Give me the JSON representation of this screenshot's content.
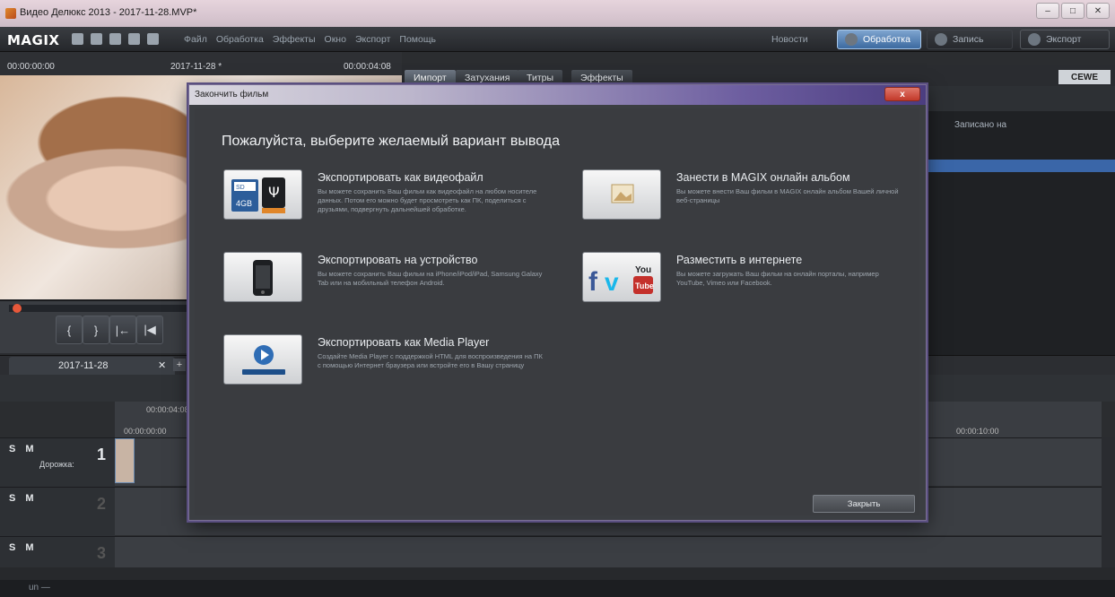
{
  "window": {
    "title": "Видео Делюкс 2013 - 2017-11-28.MVP*"
  },
  "menubar": {
    "logo": "MAGIX",
    "items": [
      "Файл",
      "Обработка",
      "Эффекты",
      "Окно",
      "Экспорт",
      "Помощь"
    ],
    "news": "Новости",
    "modes": {
      "processing": "Обработка",
      "record": "Запись",
      "export": "Экспорт"
    }
  },
  "monitor": {
    "timecode_left": "00:00:00:00",
    "project": "2017-11-28 *",
    "timecode_right": "00:00:04:08"
  },
  "media_tabs": [
    "Импорт",
    "Затухания",
    "Титры",
    "Эффекты"
  ],
  "brand_badge": "CEWE",
  "media_panel": {
    "column_recorded": "Записано на"
  },
  "timeline": {
    "tab_label": "2017-11-28",
    "ruler_marks": [
      "00:00:00:00",
      "00:00:04:08",
      "00:00:10:00"
    ],
    "tracks": [
      {
        "number": "1",
        "label": "Дорожка:"
      },
      {
        "number": "2",
        "label": ""
      },
      {
        "number": "3",
        "label": ""
      }
    ],
    "track_buttons": "S M"
  },
  "status": {
    "text": "un —"
  },
  "dialog": {
    "title": "Закончить фильм",
    "close_glyph": "x",
    "heading": "Пожалуйста, выберите желаемый вариант вывода",
    "options": {
      "video_file": {
        "title": "Экспортировать как видеофайл",
        "desc": "Вы можете сохранить Ваш фильм как видеофайл на любом носителе данных. Потом его можно будет просмотреть как ПК, поделиться с друзьями, подвергнуть дальнейшей обработке."
      },
      "device": {
        "title": "Экспортировать на устройство",
        "desc": "Вы можете сохранить Ваш фильм на iPhone/iPod/iPad, Samsung Galaxy Tab или на мобильный телефон Android."
      },
      "media_player": {
        "title": "Экспортировать как Media Player",
        "desc": "Создайте Media Player с поддержкой HTML для воспроизведения на ПК с помощью Интернет браузера или встройте его в Вашу страницу"
      },
      "online_album": {
        "title": "Занести в MAGIX онлайн альбом",
        "desc": "Вы можете внести Ваш фильм в MAGIX онлайн альбом Вашей личной веб-страницы"
      },
      "internet": {
        "title": "Разместить в интернете",
        "desc": "Вы можете загружать Ваш фильм на онлайн порталы, например YouTube, Vimeo или Facebook."
      }
    },
    "close_button": "Закрыть"
  },
  "colors": {
    "accent": "#3c6aa0",
    "dialog_title": "#6d5ea0",
    "close": "#c2392a"
  }
}
